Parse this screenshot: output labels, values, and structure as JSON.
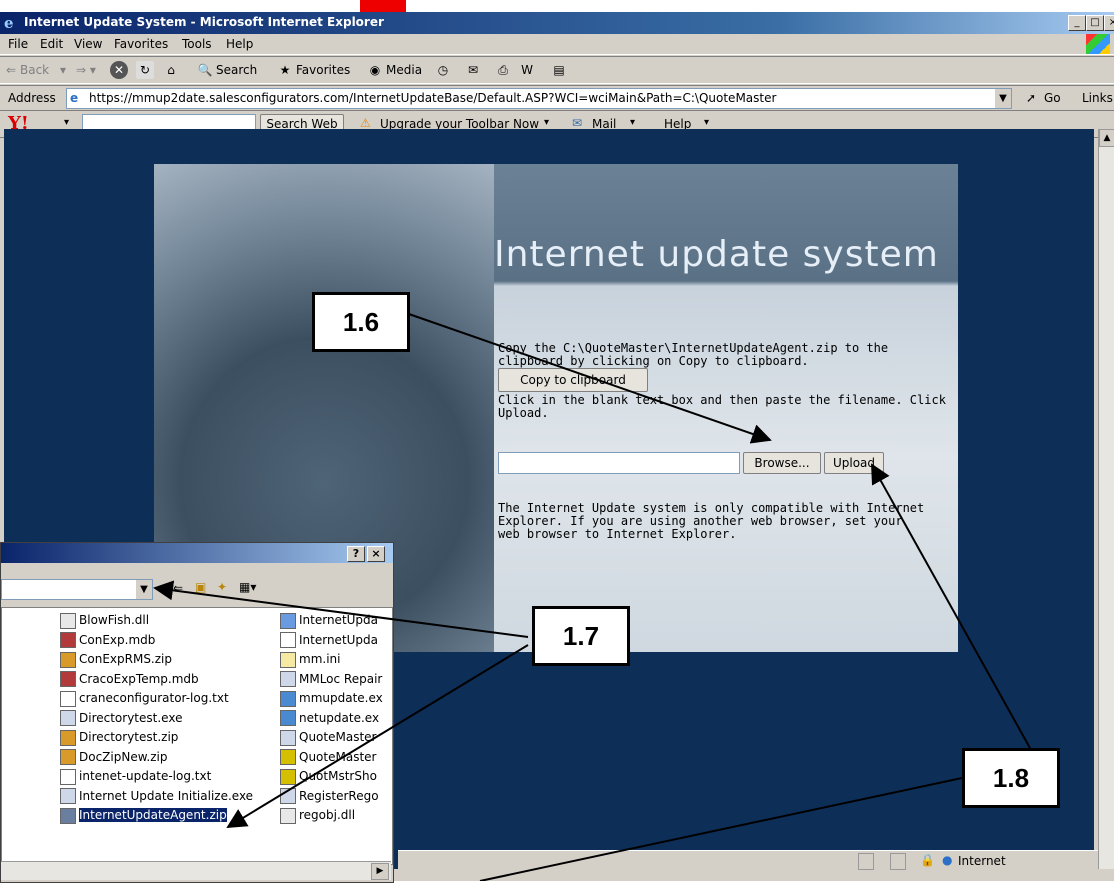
{
  "window": {
    "title": "Internet Update System - Microsoft Internet Explorer",
    "controls": [
      "_",
      "□",
      "×"
    ]
  },
  "menu": [
    "File",
    "Edit",
    "View",
    "Favorites",
    "Tools",
    "Help"
  ],
  "toolbar": {
    "back": "Back",
    "search": "Search",
    "favorites": "Favorites",
    "media": "Media"
  },
  "address": {
    "label": "Address",
    "url": "https://mmup2date.salesconfigurators.com/InternetUpdateBase/Default.ASP?WCI=wciMain&Path=C:\\QuoteMaster",
    "go": "Go",
    "links": "Links"
  },
  "yahoo_bar": {
    "logo": "Y!",
    "search_btn": "Search Web",
    "upgrade": "Upgrade your Toolbar Now",
    "mail": "Mail",
    "help": "Help"
  },
  "page": {
    "heading": "Internet update system",
    "instructions1": "Copy the C:\\QuoteMaster\\InternetUpdateAgent.zip to the\nclipboard by clicking on Copy to clipboard.",
    "copy_btn": "Copy to clipboard",
    "instructions2": "Click in the blank text box and then paste the filename. Click\nUpload.",
    "browse_btn": "Browse...",
    "upload_btn": "Upload",
    "compat_note": "The Internet Update system is only compatible with Internet\nExplorer. If you are using another web browser, set your\nweb browser to Internet Explorer."
  },
  "callouts": {
    "c16": "1.6",
    "c17": "1.7",
    "c18": "1.8"
  },
  "dialog": {
    "help_btn": "?",
    "close_btn": "×",
    "col1": [
      "BlowFish.dll",
      "ConExp.mdb",
      "ConExpRMS.zip",
      "CracoExpTemp.mdb",
      "craneconfigurator-log.txt",
      "Directorytest.exe",
      "Directorytest.zip",
      "DocZipNew.zip",
      "intenet-update-log.txt",
      "Internet Update Initialize.exe",
      "InternetUpdateAgent.zip"
    ],
    "col2": [
      "InternetUpda",
      "InternetUpda",
      "mm.ini",
      "MMLoc Repair",
      "mmupdate.ex",
      "netupdate.ex",
      "QuoteMaster",
      "QuoteMaster",
      "QuotMstrSho",
      "RegisterRego",
      "regobj.dll"
    ],
    "selected_index": 10
  },
  "status": {
    "zone": "Internet"
  }
}
